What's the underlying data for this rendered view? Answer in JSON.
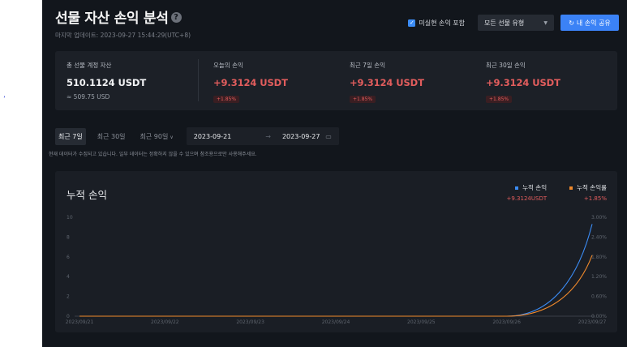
{
  "left_mark": "’",
  "header": {
    "title": "선물 자산 손익 분석",
    "help_icon": "question-icon",
    "last_updated": "마지막 업데이트: 2023-09-27 15:44:29(UTC+8)",
    "unrealized_checkbox": {
      "label": "미실현 손익 포함",
      "checked": true
    },
    "futures_type_select": {
      "value": "모든 선물 유형"
    },
    "share_button": {
      "label": "내 손익 공유",
      "icon": "share-icon"
    }
  },
  "summary": {
    "total_assets": {
      "label": "총 선물 계정 자산",
      "value": "510.1124 USDT",
      "sub": "≈ 509.75 USD"
    },
    "today_pnl": {
      "label": "오늘의 손익",
      "value": "+9.3124 USDT",
      "badge": "+1.85%"
    },
    "pnl_7d": {
      "label": "최근 7일 손익",
      "value": "+9.3124 USDT",
      "badge": "+1.85%"
    },
    "pnl_30d": {
      "label": "최근 30일 손익",
      "value": "+9.3124 USDT",
      "badge": "+1.85%"
    }
  },
  "range": {
    "tabs": [
      {
        "label": "최근 7일",
        "active": true
      },
      {
        "label": "최근 30일",
        "active": false
      },
      {
        "label": "최근 90일",
        "active": false
      }
    ],
    "start_date": "2023-09-21",
    "end_date": "2023-09-27",
    "arrow": "→",
    "notice": "현재 데이터가 수집되고 있습니다. 일부 데이터는 정확하지 않을 수 있으며 참조용으로만 사용해주세요."
  },
  "chart": {
    "title": "누적 손익",
    "legend": [
      {
        "name": "누적 손익",
        "value": "+9.3124USDT",
        "color": "#3b8cf5"
      },
      {
        "name": "누적 손익률",
        "value": "+1.85%",
        "color": "#f0892b"
      }
    ]
  },
  "chart_data": {
    "type": "line",
    "title": "누적 손익",
    "x": [
      "2023/09/21",
      "2023/09/22",
      "2023/09/23",
      "2023/09/24",
      "2023/09/25",
      "2023/09/26",
      "2023/09/27"
    ],
    "series": [
      {
        "name": "누적 손익",
        "axis": "left",
        "color": "#3b8cf5",
        "values": [
          0,
          0,
          0,
          0,
          0,
          0,
          9.3124
        ]
      },
      {
        "name": "누적 손익률",
        "axis": "right",
        "color": "#f0892b",
        "values": [
          0,
          0,
          0,
          0,
          0,
          0,
          1.85
        ]
      }
    ],
    "y_left": {
      "ticks": [
        "0",
        "2",
        "4",
        "6",
        "8",
        "10"
      ],
      "range": [
        0,
        10
      ]
    },
    "y_right": {
      "ticks": [
        "0.00%",
        "0.60%",
        "1.20%",
        "1.80%",
        "2.40%",
        "3.00%"
      ],
      "range": [
        0,
        3
      ]
    },
    "grid": false,
    "legend_position": "top-right"
  }
}
